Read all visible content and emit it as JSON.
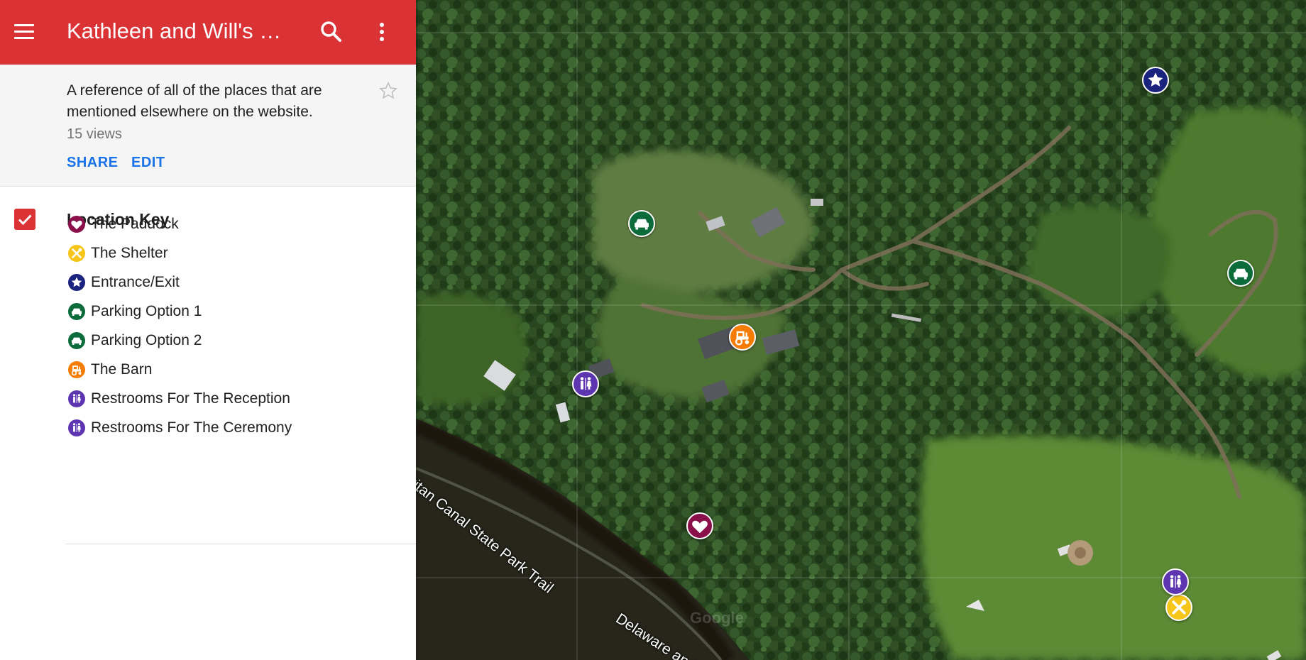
{
  "header": {
    "title": "Kathleen and Will's We...",
    "background": "#db3236",
    "icons": {
      "menu": "hamburger-menu-icon",
      "search": "search-icon",
      "more": "more-vertical-icon"
    }
  },
  "info": {
    "description": "A reference of all of the places that are mentioned elsewhere on the website.",
    "views": "15 views",
    "share_label": "SHARE",
    "edit_label": "EDIT",
    "star_icon": "star-outline-icon",
    "link_color": "#1a73e8"
  },
  "layer": {
    "title": "Location Key",
    "checked": true,
    "items": [
      {
        "label": "The Paddock",
        "icon": "heart-icon",
        "color": "#8a0f4a"
      },
      {
        "label": "The Shelter",
        "icon": "utensils-icon",
        "color": "#f5c518"
      },
      {
        "label": "Entrance/Exit",
        "icon": "star-icon",
        "color": "#1a237e"
      },
      {
        "label": "Parking Option 1",
        "icon": "car-icon",
        "color": "#0b6b3a"
      },
      {
        "label": "Parking Option 2",
        "icon": "car-icon",
        "color": "#0b6b3a"
      },
      {
        "label": "The Barn",
        "icon": "tractor-icon",
        "color": "#f57c00"
      },
      {
        "label": "Restrooms For The Reception",
        "icon": "restroom-icon",
        "color": "#5e35b1"
      },
      {
        "label": "Restrooms For The Ceremony",
        "icon": "restroom-icon",
        "color": "#5e35b1"
      }
    ]
  },
  "map": {
    "type": "satellite",
    "labels": {
      "trail": "ritan Canal State Park Trail",
      "road": "Delaware and",
      "watermark": "Google"
    }
  }
}
